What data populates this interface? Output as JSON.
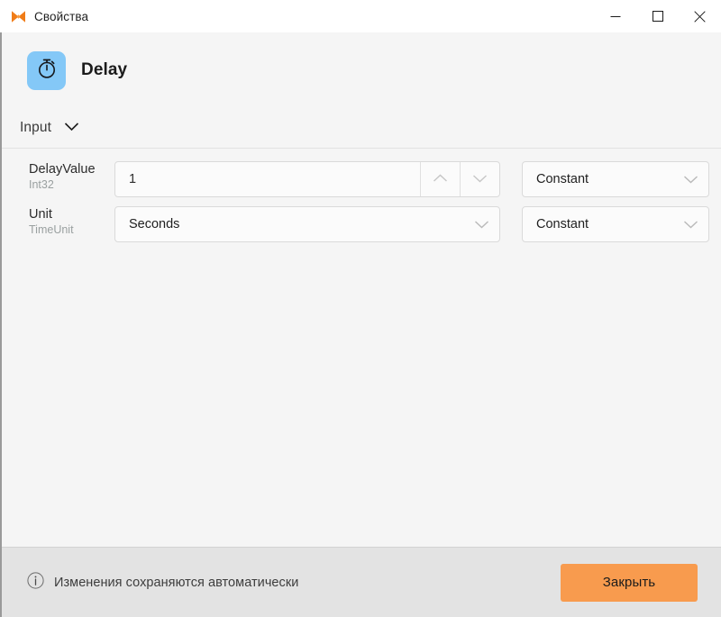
{
  "window": {
    "title": "Свойства",
    "logo_icon": "butterfly-logo-icon",
    "controls": {
      "minimize": "minimize-icon",
      "maximize": "maximize-icon",
      "close": "close-icon"
    }
  },
  "activity": {
    "title": "Delay",
    "icon": "stopwatch-icon",
    "icon_bg": "#84c8f7"
  },
  "section": {
    "label": "Input",
    "collapse_icon": "chevron-down-icon",
    "expanded": true
  },
  "properties": [
    {
      "name": "DelayValue",
      "type": "Int32",
      "control": "numeric-stepper",
      "value": "1",
      "increment_icon": "chevron-up-icon",
      "decrement_icon": "chevron-down-icon",
      "mode": "Constant",
      "mode_icon": "chevron-down-icon"
    },
    {
      "name": "Unit",
      "type": "TimeUnit",
      "control": "dropdown",
      "value": "Seconds",
      "value_icon": "chevron-down-icon",
      "mode": "Constant",
      "mode_icon": "chevron-down-icon"
    }
  ],
  "footer": {
    "info_icon": "info-circle-icon",
    "status": "Изменения сохраняются автоматически",
    "close_label": "Закрыть",
    "close_color": "#f89b4e"
  }
}
